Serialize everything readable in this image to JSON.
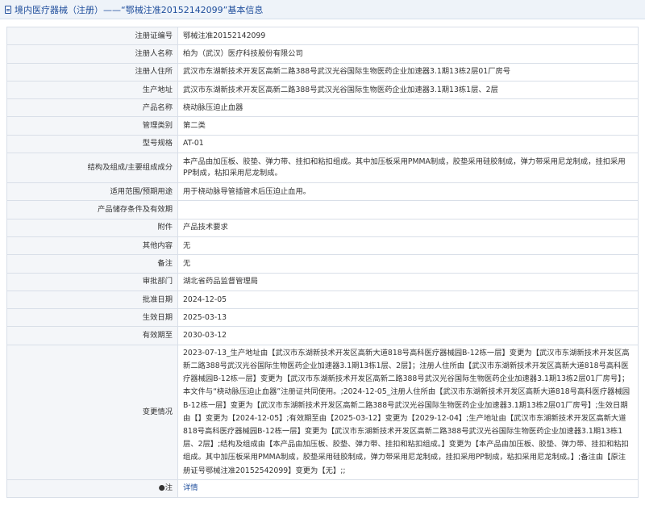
{
  "header": {
    "title": "境内医疗器械（注册）——“鄂械注准20152142099”基本信息"
  },
  "rows": [
    {
      "label": "注册证编号",
      "value": "鄂械注准20152142099"
    },
    {
      "label": "注册人名称",
      "value": "柏为（武汉）医疗科技股份有限公司"
    },
    {
      "label": "注册人住所",
      "value": "武汉市东湖新技术开发区高新二路388号武汉光谷国际生物医药企业加速器3.1期13栋2层01厂房号"
    },
    {
      "label": "生产地址",
      "value": "武汉市东湖新技术开发区高新二路388号武汉光谷国际生物医药企业加速器3.1期13栋1层、2层"
    },
    {
      "label": "产品名称",
      "value": "桡动脉压迫止血器"
    },
    {
      "label": "管理类别",
      "value": "第二类"
    },
    {
      "label": "型号规格",
      "value": "AT-01"
    },
    {
      "label": "结构及组成/主要组成成分",
      "value": "本产品由加压板、胶垫、弹力带、挂扣和粘扣组成。其中加压板采用PMMA制成，胶垫采用硅胶制成，弹力带采用尼龙制成，挂扣采用PP制成，粘扣采用尼龙制成。"
    },
    {
      "label": "适用范围/预期用途",
      "value": "用于桡动脉导管插管术后压迫止血用。"
    },
    {
      "label": "产品储存条件及有效期",
      "value": ""
    },
    {
      "label": "附件",
      "value": "产品技术要求"
    },
    {
      "label": "其他内容",
      "value": "无"
    },
    {
      "label": "备注",
      "value": "无"
    },
    {
      "label": "审批部门",
      "value": "湖北省药品监督管理局"
    },
    {
      "label": "批准日期",
      "value": "2024-12-05"
    },
    {
      "label": "生效日期",
      "value": "2025-03-13"
    },
    {
      "label": "有效期至",
      "value": "2030-03-12"
    },
    {
      "label": "变更情况",
      "value": "2023-07-13_生产地址由【武汉市东湖新技术开发区高新大道818号高科医疗器械园B-12栋一层】变更为【武汉市东湖新技术开发区高新二路388号武汉光谷国际生物医药企业加速器3.1期13栋1层、2层】；注册人住所由【武汉市东湖新技术开发区高新大道818号高科医疗器械园B-12栋一层】变更为【武汉市东湖新技术开发区高新二路388号武汉光谷国际生物医药企业加速器3.1期13栋2层01厂房号】；本文件与“桡动脉压迫止血器”注册证共同使用。;2024-12-05_注册人住所由【武汉市东湖新技术开发区高新大道818号高科医疗器械园B-12栋一层】变更为【武汉市东湖新技术开发区高新二路388号武汉光谷国际生物医药企业加速器3.1期13栋2层01厂房号】;生效日期由【】变更为【2024-12-05】;有效期至由【2025-03-12】变更为【2029-12-04】;生产地址由【武汉市东湖新技术开发区高新大道818号高科医疗器械园B-12栋一层】变更为【武汉市东湖新技术开发区高新二路388号武汉光谷国际生物医药企业加速器3.1期13栋1层、2层】;结构及组成由【本产品由加压板、胶垫、弹力带、挂扣和粘扣组成。】变更为【本产品由加压板、胶垫、弹力带、挂扣和粘扣组成。其中加压板采用PMMA制成，胶垫采用硅胶制成，弹力带采用尼龙制成，挂扣采用PP制成，粘扣采用尼龙制成。】;备注由【原注册证号鄂械注准20152542099】变更为【无】;;"
    },
    {
      "label": "●注",
      "value": "详情"
    }
  ]
}
